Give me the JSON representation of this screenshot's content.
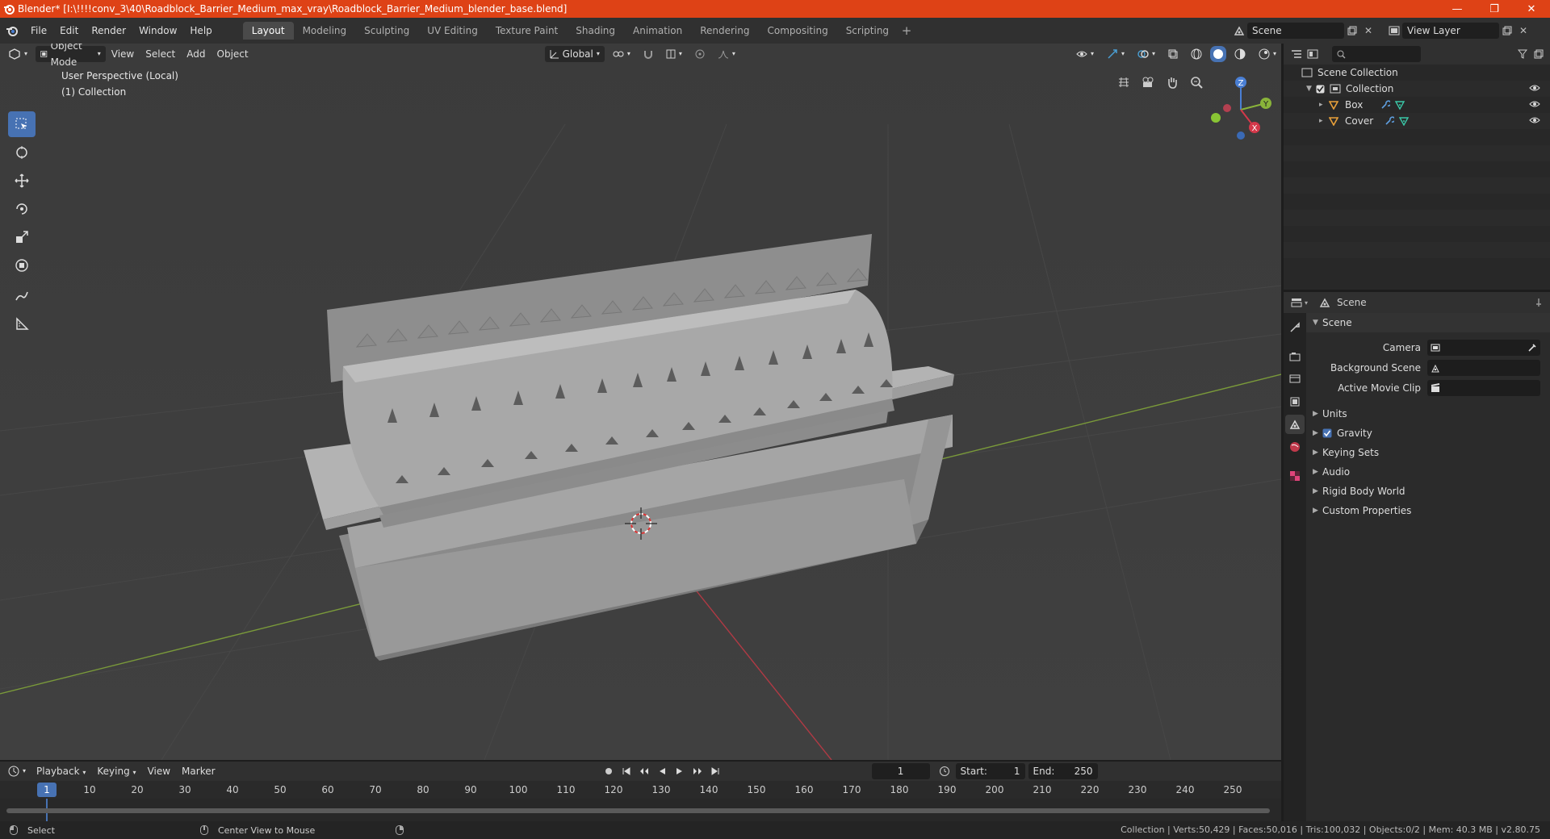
{
  "window": {
    "title": "Blender* [I:\\!!!!conv_3\\40\\Roadblock_Barrier_Medium_max_vray\\Roadblock_Barrier_Medium_blender_base.blend]",
    "minimize": "—",
    "maximize": "❐",
    "close": "✕"
  },
  "menu": [
    "File",
    "Edit",
    "Render",
    "Window",
    "Help"
  ],
  "workspaces": [
    "Layout",
    "Modeling",
    "Sculpting",
    "UV Editing",
    "Texture Paint",
    "Shading",
    "Animation",
    "Rendering",
    "Compositing",
    "Scripting"
  ],
  "workspace_active": "Layout",
  "scene_name": "Scene",
  "view_layer": "View Layer",
  "viewport": {
    "mode": "Object Mode",
    "menus": [
      "View",
      "Select",
      "Add",
      "Object"
    ],
    "transform_orientation": "Global",
    "info_line1": "User Perspective (Local)",
    "info_line2": "(1) Collection",
    "gizmo": {
      "z": "Z",
      "y": "Y",
      "x": "X"
    }
  },
  "outliner": {
    "root": "Scene Collection",
    "collection": "Collection",
    "objects": [
      "Box",
      "Cover"
    ]
  },
  "properties": {
    "context": "Scene",
    "section": "Scene",
    "fields": [
      {
        "label": "Camera",
        "value": ""
      },
      {
        "label": "Background Scene",
        "value": ""
      },
      {
        "label": "Active Movie Clip",
        "value": ""
      }
    ],
    "panels": [
      "Units",
      "Gravity",
      "Keying Sets",
      "Audio",
      "Rigid Body World",
      "Custom Properties"
    ]
  },
  "timeline": {
    "menus": [
      "Playback",
      "Keying",
      "View",
      "Marker"
    ],
    "current_frame": "1",
    "start_label": "Start:",
    "start": "1",
    "end_label": "End:",
    "end": "250",
    "ticks": [
      "1",
      "10",
      "20",
      "30",
      "40",
      "50",
      "60",
      "70",
      "80",
      "90",
      "100",
      "110",
      "120",
      "130",
      "140",
      "150",
      "160",
      "170",
      "180",
      "190",
      "200",
      "210",
      "220",
      "230",
      "240",
      "250"
    ]
  },
  "status": {
    "select": "Select",
    "center": "Center View to Mouse",
    "stats": "Collection | Verts:50,429 | Faces:50,016 | Tris:100,032 | Objects:0/2 | Mem: 40.3 MB | v2.80.75"
  },
  "colors": {
    "accent": "#4772b3",
    "titlebar": "#de4216",
    "x_axis": "#d4384a",
    "y_axis": "#89b33a",
    "z_axis": "#4a7fd4"
  }
}
